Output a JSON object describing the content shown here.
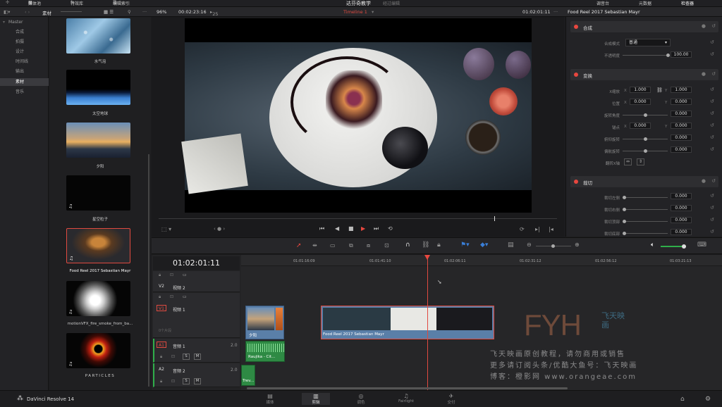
{
  "topbar": {
    "media_pool": "媒体池",
    "effects_library": "特效库",
    "edit_index": "编辑索引",
    "project_title": "达芬奇教学",
    "edited": "经过编辑",
    "mixer": "调音台",
    "metadata": "元数据",
    "inspector": "检查器"
  },
  "toolbar": {
    "bin_name": "素材",
    "zoom": "96%",
    "source_timecode": "00:02:23:16",
    "frame_label": "25",
    "timeline_name": "Timeline 1",
    "record_timecode": "01:02:01:11",
    "inspector_clip": "Food Reel 2017 Sebastian Mayr"
  },
  "sidebar": {
    "items": [
      {
        "label": "Master"
      },
      {
        "label": "合成"
      },
      {
        "label": "拍摄"
      },
      {
        "label": "设计"
      },
      {
        "label": "时间线"
      },
      {
        "label": "输出"
      },
      {
        "label": "素材"
      },
      {
        "label": "音乐"
      }
    ],
    "selected_index": 6
  },
  "media_pool": {
    "clips": [
      {
        "label": "水气泡"
      },
      {
        "label": "太空地球"
      },
      {
        "label": "夕阳"
      },
      {
        "label": "星空粒子"
      },
      {
        "label": "Food Reel 2017 Sebastian Mayr"
      },
      {
        "label": "motionVFX_fire_smoke_from_ba..."
      },
      {
        "label": "PARTICLES"
      }
    ]
  },
  "inspector": {
    "composite": {
      "title": "合成",
      "mode_label": "合成模式",
      "mode_value": "普通",
      "opacity_label": "不透明度",
      "opacity_value": "100.00"
    },
    "transform": {
      "title": "变换",
      "zoom_label": "X缩放",
      "zoom_x": "1.000",
      "zoom_y": "1.000",
      "position_label": "位置",
      "pos_x": "0.000",
      "pos_y": "0.000",
      "rotation_label": "旋转角度",
      "rotation_value": "0.000",
      "anchor_label": "锚点",
      "anchor_x": "0.000",
      "anchor_y": "0.000",
      "pitch_label": "俯仰旋转",
      "pitch_value": "0.000",
      "yaw_label": "偏航旋转",
      "yaw_value": "0.000",
      "flip_label": "翻转X轴"
    },
    "crop": {
      "title": "裁切",
      "left_label": "裁切左侧",
      "left_value": "0.000",
      "right_label": "裁切右侧",
      "right_value": "0.000",
      "top_label": "裁切顶部",
      "top_value": "0.000",
      "bottom_label": "裁切底部",
      "bottom_value": "0.000"
    }
  },
  "timeline": {
    "timecode": "01:02:01:11",
    "ruler": [
      "01:01:16:09",
      "01:01:41:10",
      "01:02:06:11",
      "01:02:31:12",
      "01:02:56:12",
      "01:03:21:13"
    ],
    "tracks": {
      "v2_id": "V2",
      "v2_name": "视频 2",
      "v1_id": "V1",
      "v1_name": "视频 1",
      "v1_count": "0个片段",
      "a1_id": "A1",
      "a1_name": "音频 1",
      "a1_level": "2.0",
      "a2_id": "A2",
      "a2_name": "音频 2",
      "a2_level": "2.0",
      "s": "S",
      "m": "M"
    },
    "clips": {
      "sunset": "夕阳",
      "food": "Food Reel 2017 Sebastian Mayr",
      "audio1": "Raujika - Cit...",
      "audio2": "Trev..."
    }
  },
  "watermark": {
    "logo": "FYH",
    "logo_cn": "飞天映画",
    "line1": "飞天映画原创教程，请勿商用或销售",
    "line2": "更多请订阅头条/优酷大鱼号：飞天映画",
    "line3": "博客：橙影网 www.orangeae.com"
  },
  "bottombar": {
    "app_name": "DaVinci Resolve 14",
    "pages": [
      "媒体",
      "剪辑",
      "调色",
      "Fairlight",
      "交付"
    ],
    "active_page": 1
  }
}
